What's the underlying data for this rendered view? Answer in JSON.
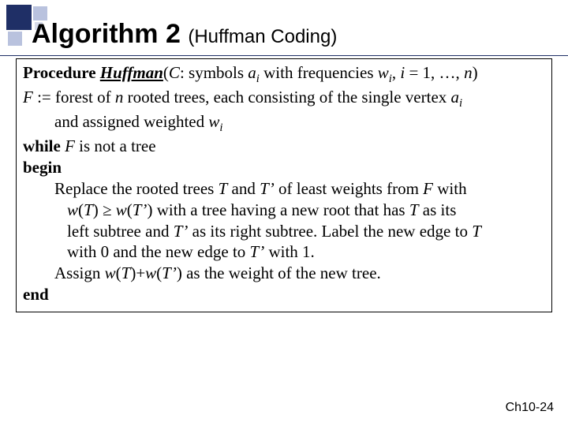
{
  "title": {
    "main": "Algorithm 2 ",
    "sub": "(Huffman Coding)"
  },
  "proc": {
    "kw": "Procedure ",
    "name": "Huffman",
    "open": "(",
    "C": "C",
    "afterC": ": symbols ",
    "a": "a",
    "sub_i1": "i",
    "withFreq": " with frequencies ",
    "w": "w",
    "sub_i2": "i",
    "comma": ", ",
    "ieq": "i",
    "rest": " = 1, …, ",
    "n": "n",
    "close": ")"
  },
  "F": {
    "F": "F",
    "assign": " := forest of ",
    "n": "n",
    "mid": " rooted trees, each consisting of the single vertex ",
    "a": "a",
    "sub_i": "i",
    "line2a": "and assigned weighted ",
    "w": "w",
    "sub_i2": "i"
  },
  "while": {
    "kw": "while ",
    "F": "F",
    "rest": " is not a tree"
  },
  "begin": "begin",
  "body": {
    "l1a": "Replace the rooted trees ",
    "T": "T",
    "l1b": " and ",
    "Tp": "T’",
    "l1c": " of least weights from ",
    "F": "F",
    "l1d": " with",
    "l2a": "w",
    "l2open": "(",
    "l2T": "T",
    "l2close": ")",
    "geq": " ≥ ",
    "l2a2": "w",
    "l2open2": "(",
    "l2Tp": "T’",
    "l2close2": ")",
    "l2rest": " with a tree having a new root that has ",
    "l2T2": "T",
    "l2end": " as its",
    "l3a": "left subtree and ",
    "l3Tp": "T’",
    "l3b": " as its right subtree. Label the new edge to ",
    "l3T": "T",
    "l4a": "with 0 and the new edge to ",
    "l4Tp": "T’",
    "l4b": " with 1.",
    "l5a": "Assign ",
    "l5w1": "w",
    "l5o1": "(",
    "l5T": "T",
    "l5c1": ")",
    "l5plus": "+",
    "l5w2": "w",
    "l5o2": "(",
    "l5Tp": "T’",
    "l5c2": ")",
    "l5rest": " as the weight of the new tree."
  },
  "end": "end",
  "footer": "Ch10-24"
}
